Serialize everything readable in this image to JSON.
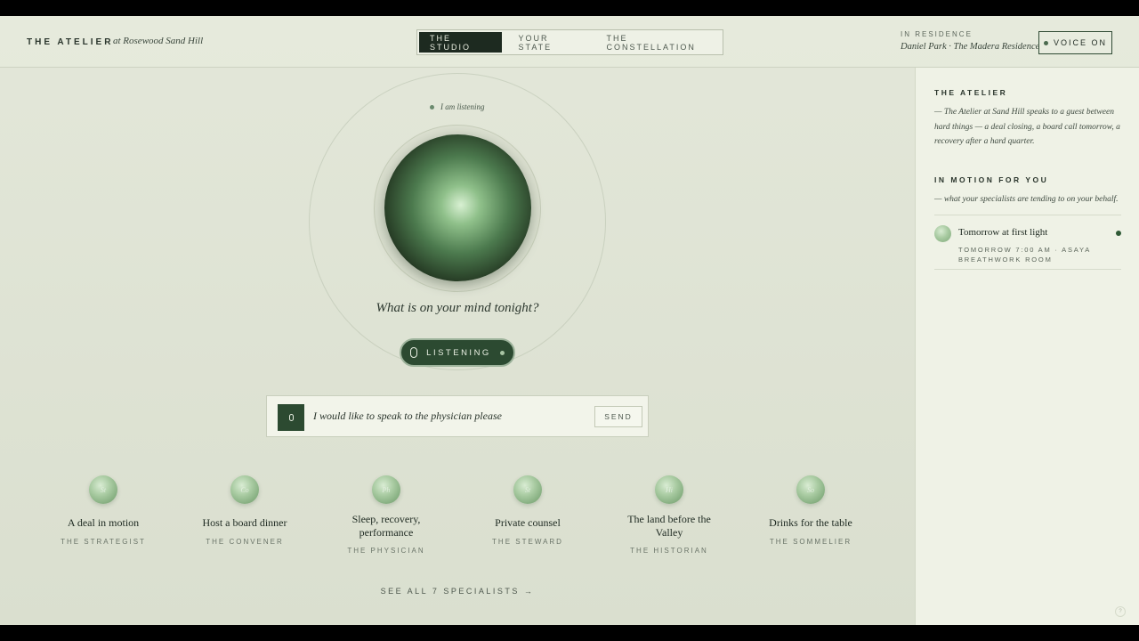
{
  "header": {
    "brand": "THE ATELIER",
    "brand_sub": "at Rosewood Sand Hill",
    "tabs": [
      {
        "label": "THE STUDIO",
        "active": true
      },
      {
        "label": "YOUR STATE",
        "active": false
      },
      {
        "label": "THE CONSTELLATION",
        "active": false
      }
    ],
    "residence_label": "IN RESIDENCE",
    "residence_name": "Daniel Park · The Madera Residence",
    "voice_button": "VOICE ON"
  },
  "studio": {
    "status": "I am listening",
    "question": "What is on your mind tonight?",
    "listen_button": "LISTENING",
    "input_value": "I would like to speak to the physician please",
    "send_button": "SEND",
    "specialists": [
      {
        "initials": "St",
        "title": "A deal in motion",
        "role": "THE STRATEGIST"
      },
      {
        "initials": "Co",
        "title": "Host a board dinner",
        "role": "THE CONVENER"
      },
      {
        "initials": "Ph",
        "title": "Sleep, recovery, performance",
        "role": "THE PHYSICIAN"
      },
      {
        "initials": "St",
        "title": "Private counsel",
        "role": "THE STEWARD"
      },
      {
        "initials": "Hi",
        "title": "The land before the Valley",
        "role": "THE HISTORIAN"
      },
      {
        "initials": "So",
        "title": "Drinks for the table",
        "role": "THE SOMMELIER"
      }
    ],
    "see_all": "SEE ALL 7 SPECIALISTS →"
  },
  "sidebar": {
    "heading": "THE ATELIER",
    "intro": "— The Atelier at Sand Hill speaks to a guest between hard things — a deal closing, a board call tomorrow, a recovery after a hard quarter.",
    "motion_heading": "IN MOTION FOR YOU",
    "motion_sub": "— what your specialists are tending to on your behalf.",
    "item": {
      "title": "Tomorrow at first light",
      "meta": "TOMORROW 7:00 AM · ASAYA BREATHWORK ROOM"
    }
  },
  "corner_glyph": "?",
  "colors": {
    "accent": "#2c4a31",
    "background": "#dfe3d4",
    "sidebar": "#eff2e6"
  }
}
